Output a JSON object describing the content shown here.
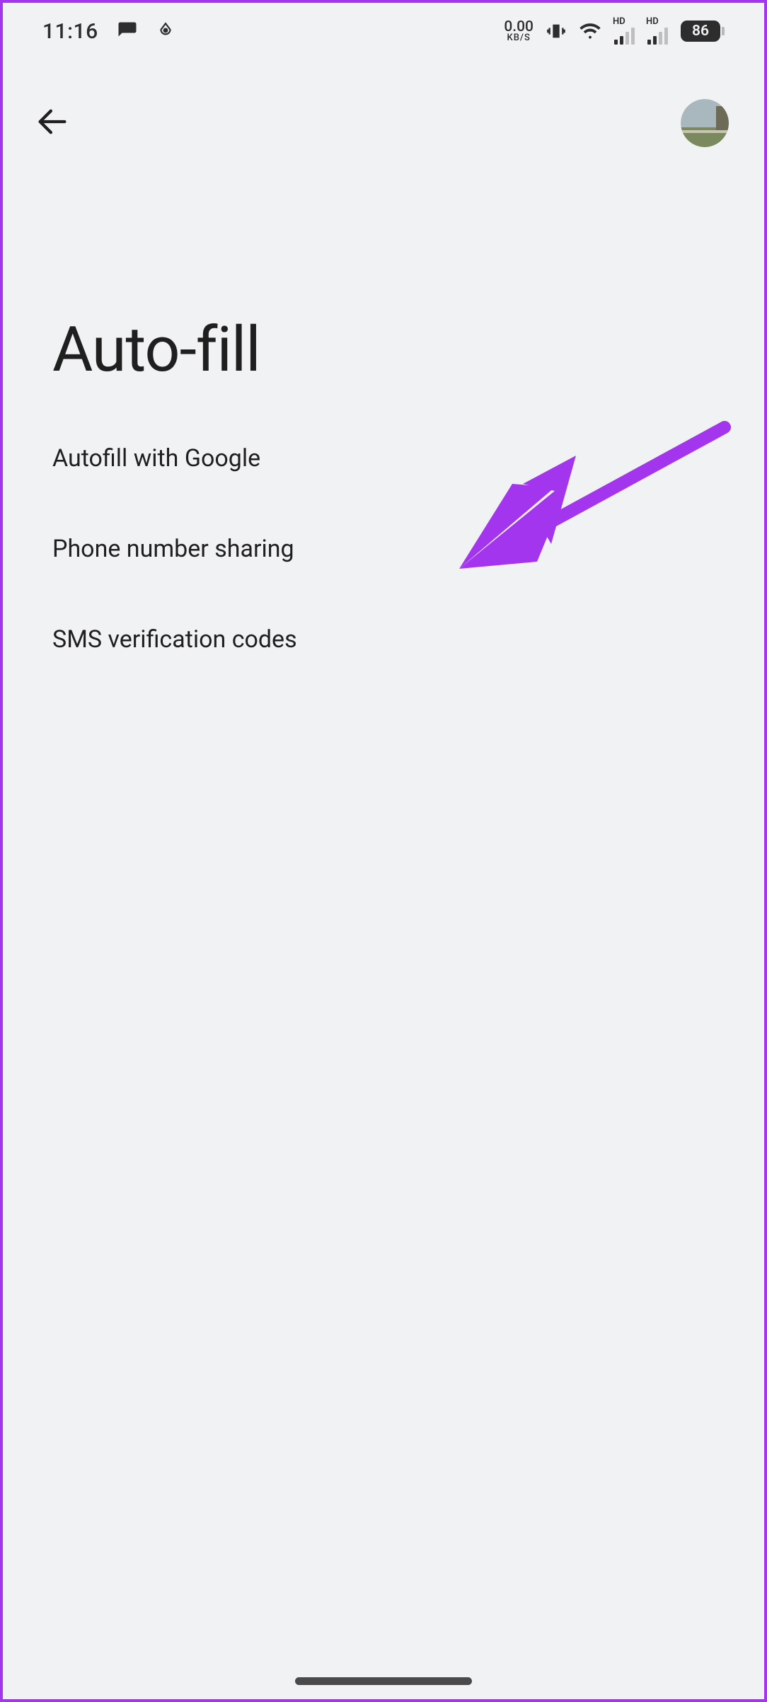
{
  "status_bar": {
    "time": "11:16",
    "data_rate_value": "0.00",
    "data_rate_unit": "KB/S",
    "signal_label_1": "HD",
    "signal_label_2": "HD",
    "battery_percent": "86"
  },
  "header": {
    "title": "Auto-fill"
  },
  "list": {
    "items": [
      {
        "label": "Autofill with Google"
      },
      {
        "label": "Phone number sharing"
      },
      {
        "label": "SMS verification codes"
      }
    ]
  },
  "annotation": {
    "color": "#a335ef"
  }
}
